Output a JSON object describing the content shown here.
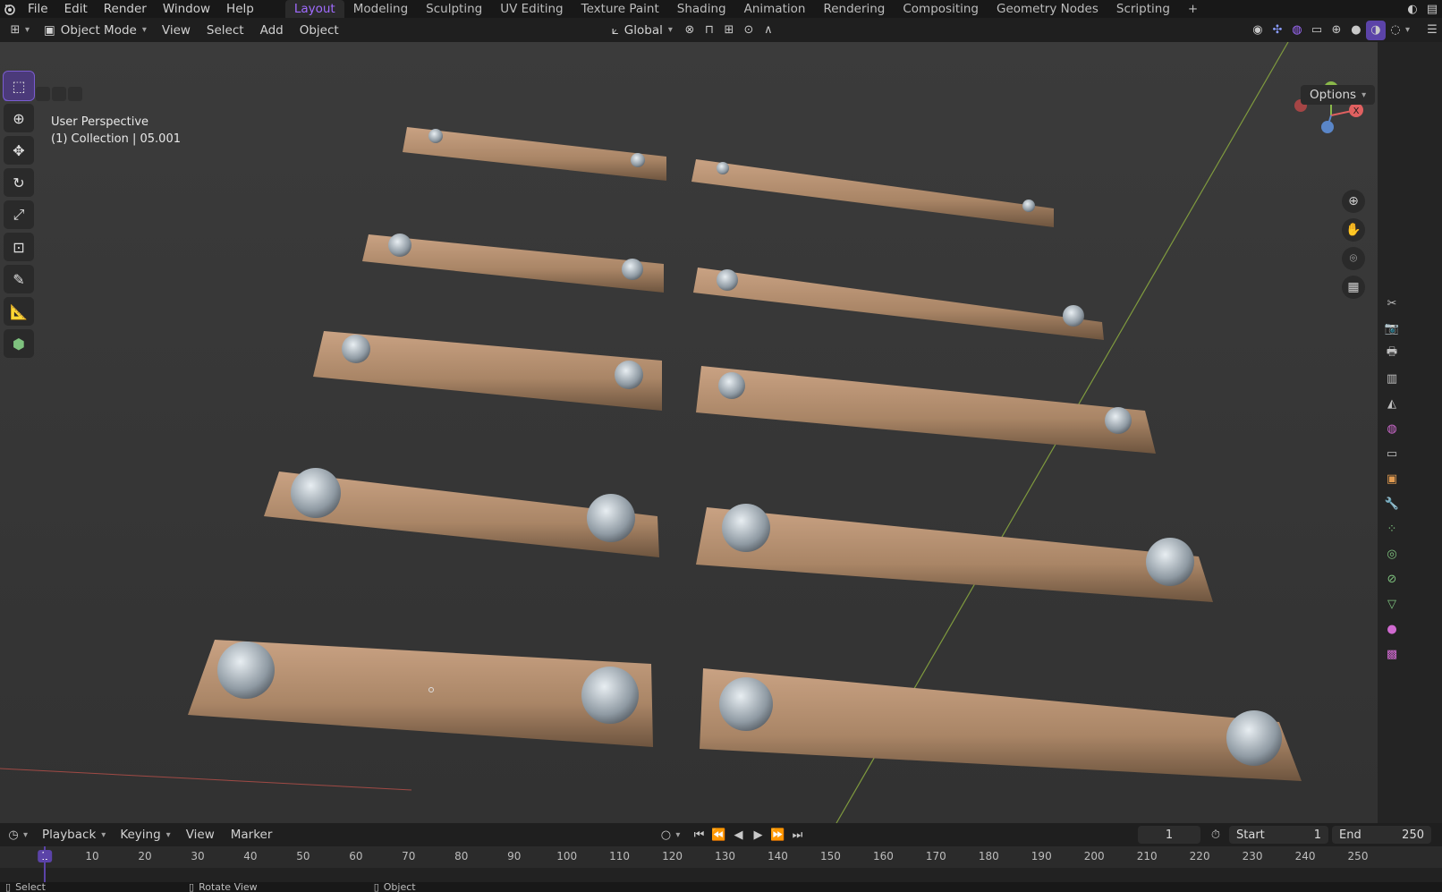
{
  "menubar": {
    "items": [
      "File",
      "Edit",
      "Render",
      "Window",
      "Help"
    ],
    "workspaces": [
      "Layout",
      "Modeling",
      "Sculpting",
      "UV Editing",
      "Texture Paint",
      "Shading",
      "Animation",
      "Rendering",
      "Compositing",
      "Geometry Nodes",
      "Scripting"
    ],
    "active_workspace": "Layout",
    "add_tab": "+"
  },
  "header": {
    "mode": "Object Mode",
    "menus": [
      "View",
      "Select",
      "Add",
      "Object"
    ],
    "orientation": "Global",
    "options_label": "Options"
  },
  "viewport": {
    "line1": "User Perspective",
    "line2": "(1) Collection | 05.001",
    "gizmo": {
      "x_label": "X"
    },
    "background": "#3d3d3d",
    "object_color": "#b08a6a"
  },
  "toolbar": {
    "tools": [
      "select-box-icon",
      "cursor-icon",
      "move-icon",
      "rotate-icon",
      "scale-icon",
      "transform-icon",
      "annotate-icon",
      "measure-icon",
      "add-cube-icon"
    ]
  },
  "timeline": {
    "menus": [
      "Playback",
      "Keying",
      "View",
      "Marker"
    ],
    "current_frame": "1",
    "start_label": "Start",
    "start_value": "1",
    "end_label": "End",
    "end_value": "250",
    "ticks": [
      "1",
      "10",
      "20",
      "30",
      "40",
      "50",
      "60",
      "70",
      "80",
      "90",
      "100",
      "110",
      "120",
      "130",
      "140",
      "150",
      "160",
      "170",
      "180",
      "190",
      "200",
      "210",
      "220",
      "230",
      "240",
      "250"
    ]
  },
  "statusbar": {
    "select": "Select",
    "rotate": "Rotate View",
    "object": "Object"
  },
  "colors": {
    "accent": "#7a5cd0",
    "x_axis": "#e06060",
    "y_axis": "#8ab84a",
    "z_axis": "#5a86c8"
  }
}
